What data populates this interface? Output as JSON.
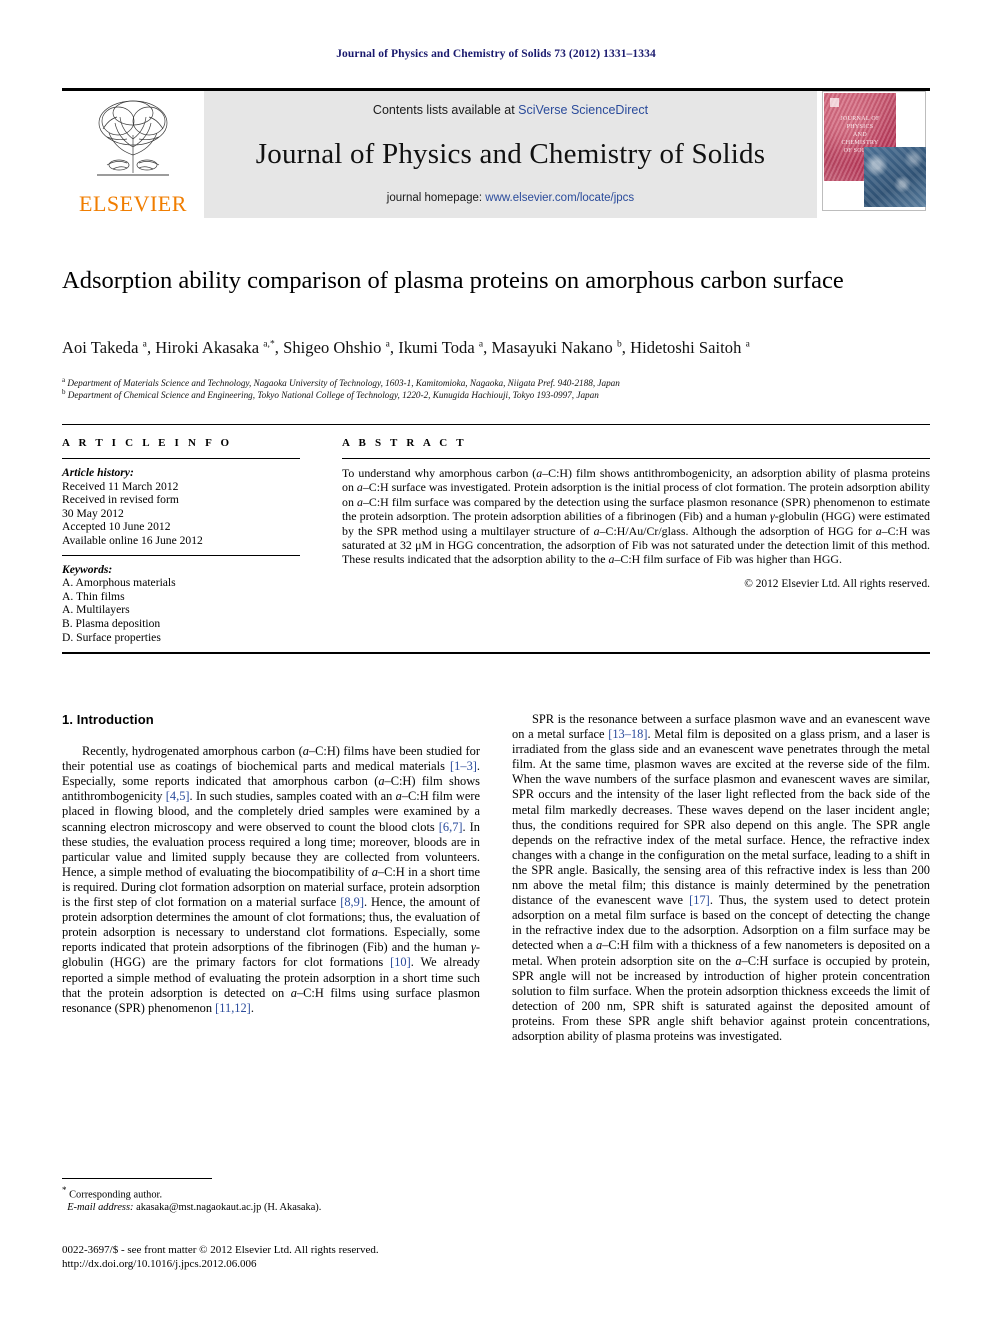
{
  "running_head": "Journal of Physics and Chemistry of Solids 73 (2012) 1331–1334",
  "masthead": {
    "publisher": "ELSEVIER",
    "contents_prefix": "Contents lists available at ",
    "contents_link": "SciVerse ScienceDirect",
    "journal_title": "Journal of Physics and Chemistry of Solids",
    "homepage_prefix": "journal homepage: ",
    "homepage_link": "www.elsevier.com/locate/jpcs",
    "cover_text": "JOURNAL OF\nPHYSICS\nAND\nCHEMISTRY\nOF SOLIDS"
  },
  "article": {
    "title": "Adsorption ability comparison of plasma proteins on amorphous carbon surface",
    "authors_html": "Aoi Takeda <sup>a</sup>, Hiroki Akasaka <sup>a,*</sup>, Shigeo Ohshio <sup>a</sup>, Ikumi Toda <sup>a</sup>, Masayuki Nakano <sup>b</sup>, Hidetoshi Saitoh <sup>a</sup>",
    "affiliation_a": "Department of Materials Science and Technology, Nagaoka University of Technology, 1603-1, Kamitomioka, Nagaoka, Niigata Pref. 940-2188, Japan",
    "affiliation_b": "Department of Chemical Science and Engineering, Tokyo National College of Technology, 1220-2, Kunugida Hachiouji, Tokyo 193-0997, Japan"
  },
  "article_info": {
    "heading": "A R T I C L E  I N F O",
    "history_label": "Article history:",
    "history": [
      "Received 11 March 2012",
      "Received in revised form",
      "30 May 2012",
      "Accepted 10 June 2012",
      "Available online 16 June 2012"
    ],
    "keywords_label": "Keywords:",
    "keywords": [
      "A. Amorphous materials",
      "A. Thin films",
      "A. Multilayers",
      "B. Plasma deposition",
      "D. Surface properties"
    ]
  },
  "abstract": {
    "heading": "A B S T R A C T",
    "text": "To understand why amorphous carbon (a–C:H) film shows antithrombogenicity, an adsorption ability of plasma proteins on a–C:H surface was investigated. Protein adsorption is the initial process of clot formation. The protein adsorption ability on a–C:H film surface was compared by the detection using the surface plasmon resonance (SPR) phenomenon to estimate the protein adsorption. The protein adsorption abilities of a fibrinogen (Fib) and a human γ-globulin (HGG) were estimated by the SPR method using a multilayer structure of a–C:H/Au/Cr/glass. Although the adsorption of HGG for a–C:H was saturated at 32 μM in HGG concentration, the adsorption of Fib was not saturated under the detection limit of this method. These results indicated that the adsorption ability to the a–C:H film surface of Fib was higher than HGG.",
    "copyright": "© 2012 Elsevier Ltd. All rights reserved."
  },
  "body": {
    "section_heading": "1.  Introduction",
    "left_paragraph": "Recently, hydrogenated amorphous carbon (a–C:H) films have been studied for their potential use as coatings of biochemical parts and medical materials [1–3]. Especially, some reports indicated that amorphous carbon (a–C:H) film shows antithrombogenicity [4,5]. In such studies, samples coated with an a–C:H film were placed in flowing blood, and the completely dried samples were examined by a scanning electron microscopy and were observed to count the blood clots [6,7]. In these studies, the evaluation process required a long time; moreover, bloods are in particular value and limited supply because they are collected from volunteers. Hence, a simple method of evaluating the biocompatibility of a–C:H in a short time is required. During clot formation adsorption on material surface, protein adsorption is the first step of clot formation on a material surface [8,9]. Hence, the amount of protein adsorption determines the amount of clot formations; thus, the evaluation of protein adsorption is necessary to understand clot formations. Especially, some reports indicated that protein adsorptions of the fibrinogen (Fib) and the human γ-globulin (HGG) are the primary factors for clot formations [10]. We already reported a simple method of evaluating the protein adsorption in a short time such that the protein adsorption is detected on a–C:H films using surface plasmon resonance (SPR) phenomenon [11,12].",
    "right_paragraph": "SPR is the resonance between a surface plasmon wave and an evanescent wave on a metal surface [13–18]. Metal film is deposited on a glass prism, and a laser is irradiated from the glass side and an evanescent wave penetrates through the metal film. At the same time, plasmon waves are excited at the reverse side of the film. When the wave numbers of the surface plasmon and evanescent waves are similar, SPR occurs and the intensity of the laser light reflected from the back side of the metal film markedly decreases. These waves depend on the laser incident angle; thus, the conditions required for SPR also depend on this angle. The SPR angle depends on the refractive index of the metal surface. Hence, the refractive index changes with a change in the configuration on the metal surface, leading to a shift in the SPR angle. Basically, the sensing area of this refractive index is less than 200 nm above the metal film; this distance is mainly determined by the penetration distance of the evanescent wave [17]. Thus, the system used to detect protein adsorption on a metal film surface is based on the concept of detecting the change in the refractive index due to the adsorption. Adsorption on a film surface may be detected when a a–C:H film with a thickness of a few nanometers is deposited on a metal. When protein adsorption site on the a–C:H surface is occupied by protein, SPR angle will not be increased by introduction of higher protein concentration solution to film surface. When the protein adsorption thickness exceeds the limit of detection of 200 nm, SPR shift is saturated against the deposited amount of proteins. From these SPR angle shift behavior against protein concentrations, adsorption ability of plasma proteins was investigated."
  },
  "footnote": {
    "corresponding": "Corresponding author.",
    "email_label": "E-mail address:",
    "email": "akasaka@mst.nagaokaut.ac.jp (H. Akasaka)."
  },
  "footer": {
    "issn_line": "0022-3697/$ - see front matter © 2012 Elsevier Ltd. All rights reserved.",
    "doi_line": "http://dx.doi.org/10.1016/j.jpcs.2012.06.006"
  },
  "colors": {
    "running_head": "#1a1a6e",
    "link": "#2a4b9b",
    "elsevier_orange": "#f07d00",
    "masthead_bg": "#e6e6e6"
  }
}
